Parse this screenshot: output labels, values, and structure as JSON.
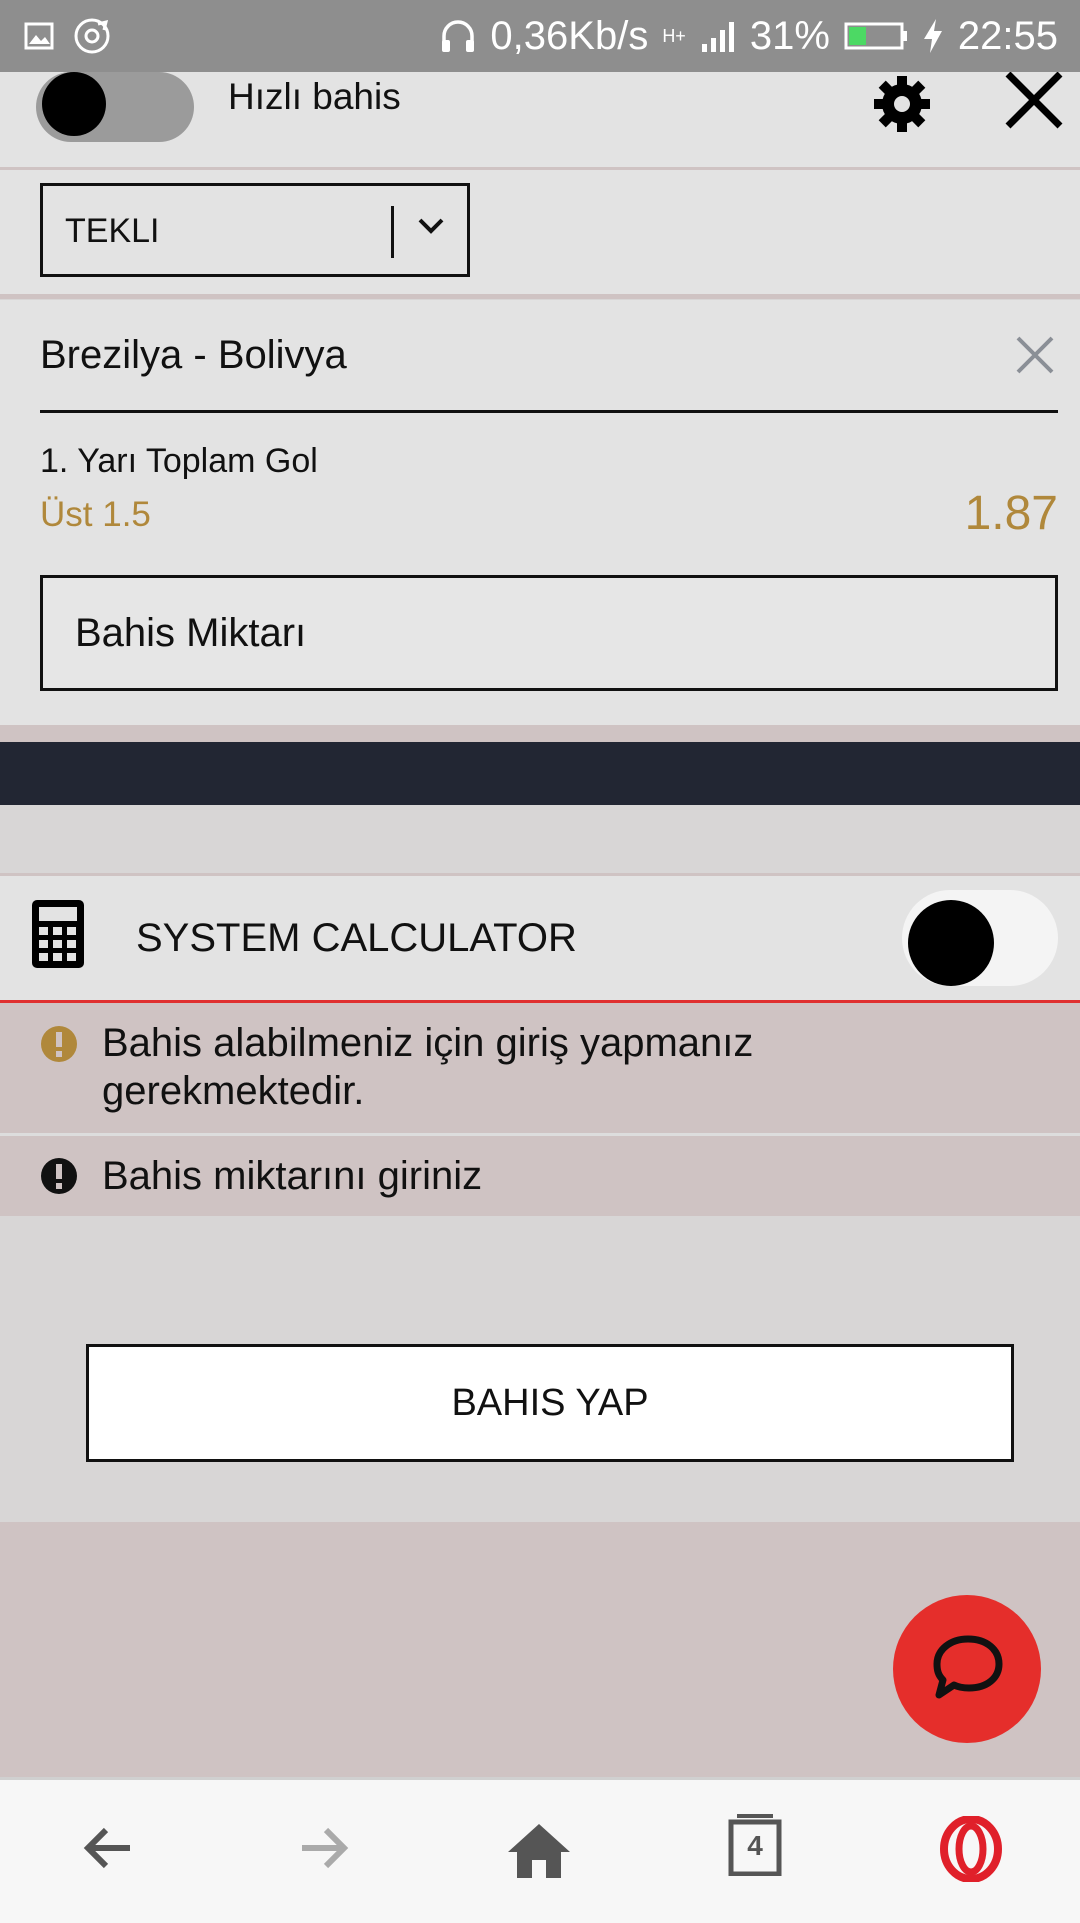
{
  "status_bar": {
    "network_speed": "0,36Kb/s",
    "network_type": "H+",
    "battery": "31%",
    "time": "22:55",
    "icons": [
      "image-icon",
      "sync-icon",
      "headphones-icon",
      "signal-icon",
      "battery-icon",
      "charging-icon"
    ]
  },
  "header": {
    "quick_bet_label": "Hızlı bahis",
    "quick_bet_on": false,
    "icons": [
      "settings-icon",
      "close-icon"
    ]
  },
  "bet_type": {
    "selected": "TEKLI"
  },
  "bet": {
    "match": "Brezilya - Bolivya",
    "market": "1. Yarı Toplam Gol",
    "selection": "Üst 1.5",
    "odds": "1.87",
    "stake_placeholder": "Bahis Miktarı"
  },
  "system_calculator": {
    "label": "SYSTEM CALCULATOR",
    "enabled": false
  },
  "warnings": [
    {
      "text": "Bahis alabilmeniz için giriş yapmanız gerekmektedir.",
      "color": "#b0883b"
    },
    {
      "text": "Bahis miktarını giriniz",
      "color": "#111111"
    }
  ],
  "submit_label": "BAHIS YAP",
  "nav": {
    "tabs_count": "4",
    "icons": [
      "back-icon",
      "forward-icon",
      "home-icon",
      "tabs-icon",
      "opera-icon"
    ]
  },
  "colors": {
    "accent_gold": "#b0883b",
    "error_red": "#e03030",
    "fab_red": "#e52e2b",
    "dark_bar": "#222633"
  }
}
